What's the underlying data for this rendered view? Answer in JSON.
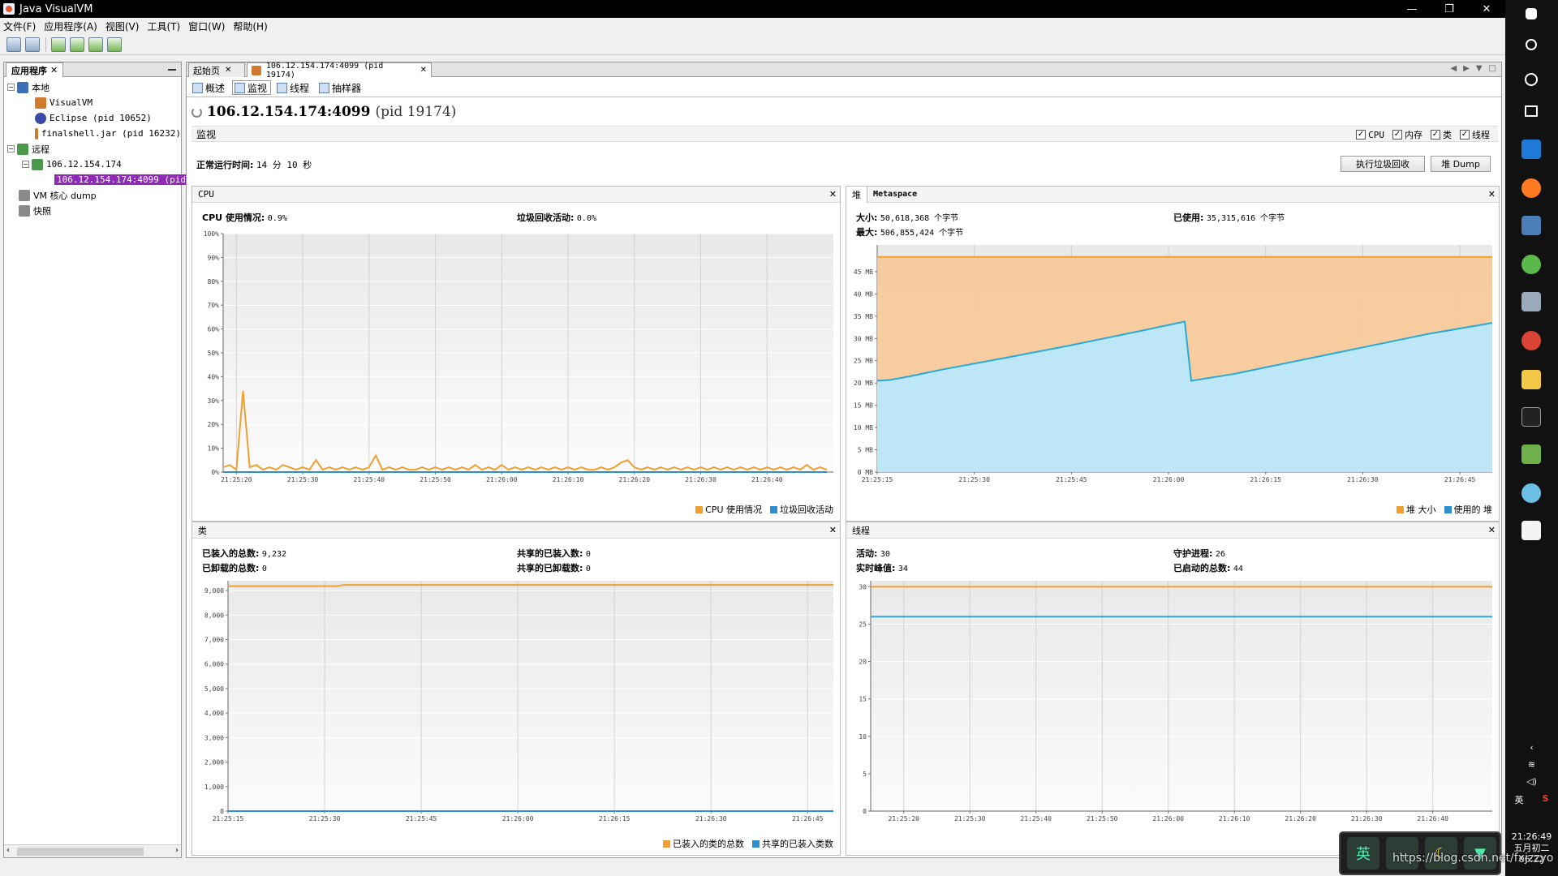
{
  "window": {
    "title": "Java VisualVM",
    "controls": [
      "—",
      "❐",
      "✕"
    ]
  },
  "menu": [
    "文件(F)",
    "应用程序(A)",
    "视图(V)",
    "工具(T)",
    "窗口(W)",
    "帮助(H)"
  ],
  "left_panel": {
    "tab_label": "应用程序",
    "tree": [
      {
        "label": "本地",
        "level": 0,
        "icon": "computer-icon",
        "expanded": true
      },
      {
        "label": "VisualVM",
        "level": 1,
        "icon": "java-icon"
      },
      {
        "label": "Eclipse (pid 10652)",
        "level": 1,
        "icon": "eclipse-icon"
      },
      {
        "label": "finalshell.jar (pid 16232)",
        "level": 1,
        "icon": "java-icon"
      },
      {
        "label": "远程",
        "level": 0,
        "icon": "network-icon",
        "expanded": true
      },
      {
        "label": "106.12.154.174",
        "level": 1,
        "icon": "host-icon",
        "expanded": true
      },
      {
        "label": "106.12.154.174:4099 (pid",
        "level": 2,
        "icon": "jmx-icon",
        "selected": true
      },
      {
        "label": "VM 核心 dump",
        "level": 0,
        "icon": "dump-icon"
      },
      {
        "label": "快照",
        "level": 0,
        "icon": "snapshot-icon"
      }
    ]
  },
  "doc_tabs": [
    {
      "label": "起始页",
      "active": false
    },
    {
      "label": "106.12.154.174:4099 (pid 19174)",
      "active": true
    }
  ],
  "sub_tabs": [
    {
      "label": "概述",
      "active": false
    },
    {
      "label": "监视",
      "active": true
    },
    {
      "label": "线程",
      "active": false
    },
    {
      "label": "抽样器",
      "active": false
    }
  ],
  "app_header": {
    "host": "106.12.154.174:4099",
    "pid": "(pid 19174)"
  },
  "monitor": {
    "label": "监视",
    "checkboxes": [
      {
        "label": "CPU",
        "checked": true
      },
      {
        "label": "内存",
        "checked": true
      },
      {
        "label": "类",
        "checked": true
      },
      {
        "label": "线程",
        "checked": true
      }
    ],
    "uptime_label": "正常运行时间:",
    "uptime_value": "14 分 10 秒",
    "gc_button": "执行垃圾回收",
    "heapdump_button": "堆 Dump"
  },
  "panels": {
    "cpu": {
      "title": "CPU",
      "stats": [
        {
          "label": "CPU 使用情况:",
          "value": "0.9%"
        },
        {
          "label": "垃圾回收活动:",
          "value": "0.0%"
        }
      ],
      "legend": [
        "CPU 使用情况",
        "垃圾回收活动"
      ]
    },
    "heap": {
      "tabs": [
        "堆",
        "Metaspace"
      ],
      "stats": [
        {
          "label": "大小:",
          "value": "50,618,368 个字节"
        },
        {
          "label": "最大:",
          "value": "506,855,424 个字节"
        },
        {
          "label": "已使用:",
          "value": "35,315,616 个字节"
        }
      ],
      "legend": [
        "堆 大小",
        "使用的 堆"
      ]
    },
    "classes": {
      "title": "类",
      "stats": [
        {
          "label": "已装入的总数:",
          "value": "9,232"
        },
        {
          "label": "已卸载的总数:",
          "value": "0"
        },
        {
          "label": "共享的已装入数:",
          "value": "0"
        },
        {
          "label": "共享的已卸载数:",
          "value": "0"
        }
      ],
      "legend": [
        "已装入的类的总数",
        "共享的已装入类数"
      ]
    },
    "threads": {
      "title": "线程",
      "stats": [
        {
          "label": "活动:",
          "value": "30"
        },
        {
          "label": "实时峰值:",
          "value": "34"
        },
        {
          "label": "守护进程:",
          "value": "26"
        },
        {
          "label": "已启动的总数:",
          "value": "44"
        }
      ],
      "legend": []
    }
  },
  "chart_data": [
    {
      "type": "line",
      "title": "CPU",
      "x": [
        "21:25:20",
        "21:25:30",
        "21:25:40",
        "21:25:50",
        "21:26:00",
        "21:26:10",
        "21:26:20",
        "21:26:30",
        "21:26:40"
      ],
      "xrange_sec": [
        0,
        92
      ],
      "tick_offsets_sec": [
        2,
        12,
        22,
        32,
        42,
        52,
        62,
        72,
        82
      ],
      "ylim": [
        0,
        100
      ],
      "yticks": [
        "0%",
        "10%",
        "20%",
        "30%",
        "40%",
        "50%",
        "60%",
        "70%",
        "80%",
        "90%",
        "100%"
      ],
      "series": [
        {
          "name": "CPU 使用情况",
          "color": "#f0a030",
          "points": [
            [
              0,
              2
            ],
            [
              1,
              3
            ],
            [
              2,
              1
            ],
            [
              3,
              34
            ],
            [
              4,
              2
            ],
            [
              5,
              3
            ],
            [
              6,
              1
            ],
            [
              7,
              2
            ],
            [
              8,
              1
            ],
            [
              9,
              3
            ],
            [
              10,
              2
            ],
            [
              11,
              1
            ],
            [
              12,
              2
            ],
            [
              13,
              1
            ],
            [
              14,
              5
            ],
            [
              15,
              1
            ],
            [
              16,
              2
            ],
            [
              17,
              1
            ],
            [
              18,
              2
            ],
            [
              19,
              1
            ],
            [
              20,
              2
            ],
            [
              21,
              1
            ],
            [
              22,
              2
            ],
            [
              23,
              7
            ],
            [
              24,
              1
            ],
            [
              25,
              2
            ],
            [
              26,
              1
            ],
            [
              27,
              2
            ],
            [
              28,
              1
            ],
            [
              29,
              1
            ],
            [
              30,
              2
            ],
            [
              31,
              1
            ],
            [
              32,
              2
            ],
            [
              33,
              1
            ],
            [
              34,
              2
            ],
            [
              35,
              1
            ],
            [
              36,
              2
            ],
            [
              37,
              1
            ],
            [
              38,
              3
            ],
            [
              39,
              1
            ],
            [
              40,
              2
            ],
            [
              41,
              1
            ],
            [
              42,
              3
            ],
            [
              43,
              1
            ],
            [
              44,
              2
            ],
            [
              45,
              1
            ],
            [
              46,
              2
            ],
            [
              47,
              1
            ],
            [
              48,
              2
            ],
            [
              49,
              1
            ],
            [
              50,
              2
            ],
            [
              51,
              1
            ],
            [
              52,
              2
            ],
            [
              53,
              1
            ],
            [
              54,
              2
            ],
            [
              55,
              1
            ],
            [
              56,
              1
            ],
            [
              57,
              2
            ],
            [
              58,
              1
            ],
            [
              59,
              2
            ],
            [
              60,
              4
            ],
            [
              61,
              5
            ],
            [
              62,
              2
            ],
            [
              63,
              1
            ],
            [
              64,
              2
            ],
            [
              65,
              1
            ],
            [
              66,
              2
            ],
            [
              67,
              1
            ],
            [
              68,
              2
            ],
            [
              69,
              1
            ],
            [
              70,
              2
            ],
            [
              71,
              1
            ],
            [
              72,
              2
            ],
            [
              73,
              1
            ],
            [
              74,
              2
            ],
            [
              75,
              1
            ],
            [
              76,
              2
            ],
            [
              77,
              1
            ],
            [
              78,
              2
            ],
            [
              79,
              1
            ],
            [
              80,
              2
            ],
            [
              81,
              1
            ],
            [
              82,
              2
            ],
            [
              83,
              1
            ],
            [
              84,
              2
            ],
            [
              85,
              1
            ],
            [
              86,
              2
            ],
            [
              87,
              1
            ],
            [
              88,
              3
            ],
            [
              89,
              1
            ],
            [
              90,
              2
            ],
            [
              91,
              1
            ]
          ]
        },
        {
          "name": "垃圾回收活动",
          "color": "#2e8fd0",
          "points": [
            [
              0,
              0
            ],
            [
              91,
              0
            ]
          ]
        }
      ]
    },
    {
      "type": "area",
      "title": "堆",
      "x": [
        "21:25:15",
        "21:25:30",
        "21:25:45",
        "21:26:00",
        "21:26:15",
        "21:26:30",
        "21:26:45"
      ],
      "xrange_sec": [
        0,
        95
      ],
      "tick_offsets_sec": [
        0,
        15,
        30,
        45,
        60,
        75,
        90
      ],
      "ylim": [
        0,
        51
      ],
      "yticks": [
        "0 MB",
        "5 MB",
        "10 MB",
        "15 MB",
        "20 MB",
        "25 MB",
        "30 MB",
        "35 MB",
        "40 MB",
        "45 MB"
      ],
      "series": [
        {
          "name": "堆 大小",
          "color": "#f0a030",
          "points": [
            [
              0,
              48.3
            ],
            [
              95,
              48.3
            ]
          ]
        },
        {
          "name": "使用的 堆",
          "color": "#2aa8d8",
          "points": [
            [
              0,
              20.5
            ],
            [
              2,
              20.7
            ],
            [
              5,
              21.5
            ],
            [
              10,
              23
            ],
            [
              20,
              25.7
            ],
            [
              30,
              28.5
            ],
            [
              35,
              30
            ],
            [
              40,
              31.5
            ],
            [
              47.5,
              33.8
            ],
            [
              48.5,
              20.5
            ],
            [
              55,
              22
            ],
            [
              65,
              25
            ],
            [
              75,
              28
            ],
            [
              85,
              31
            ],
            [
              95,
              33.5
            ]
          ]
        }
      ]
    },
    {
      "type": "line",
      "title": "类",
      "x": [
        "21:25:15",
        "21:25:30",
        "21:25:45",
        "21:26:00",
        "21:26:15",
        "21:26:30",
        "21:26:45"
      ],
      "xrange_sec": [
        0,
        94
      ],
      "tick_offsets_sec": [
        0,
        15,
        30,
        45,
        60,
        75,
        90
      ],
      "ylim": [
        0,
        9400
      ],
      "yticks": [
        "0",
        "1,000",
        "2,000",
        "3,000",
        "4,000",
        "5,000",
        "6,000",
        "7,000",
        "8,000",
        "9,000"
      ],
      "series": [
        {
          "name": "已装入的类的总数",
          "color": "#f0a030",
          "points": [
            [
              0,
              9180
            ],
            [
              17,
              9180
            ],
            [
              18,
              9232
            ],
            [
              94,
              9232
            ]
          ]
        },
        {
          "name": "共享的已装入类数",
          "color": "#2e8fd0",
          "points": [
            [
              0,
              0
            ],
            [
              94,
              0
            ]
          ]
        }
      ]
    },
    {
      "type": "line",
      "title": "线程",
      "x": [
        "21:25:20",
        "21:25:30",
        "21:25:40",
        "21:25:50",
        "21:26:00",
        "21:26:10",
        "21:26:20",
        "21:26:30",
        "21:26:40"
      ],
      "xrange_sec": [
        0,
        94
      ],
      "tick_offsets_sec": [
        5,
        15,
        25,
        35,
        45,
        55,
        65,
        75,
        85
      ],
      "ylim": [
        0,
        30.8
      ],
      "yticks": [
        "0",
        "5",
        "10",
        "15",
        "20",
        "25",
        "30"
      ],
      "series": [
        {
          "name": "活动",
          "color": "#f0a030",
          "points": [
            [
              0,
              30
            ],
            [
              94,
              30
            ]
          ]
        },
        {
          "name": "守护进程",
          "color": "#2aa8d8",
          "points": [
            [
              0,
              26
            ],
            [
              94,
              26
            ]
          ]
        }
      ]
    }
  ],
  "ime": {
    "label": "英"
  },
  "system_tray": {
    "time": "21:26:49",
    "date_line": "五月初二",
    "date_extra": "06:22",
    "lang": "英"
  },
  "watermark": "https://blog.csdn.net/fxjzzyo"
}
